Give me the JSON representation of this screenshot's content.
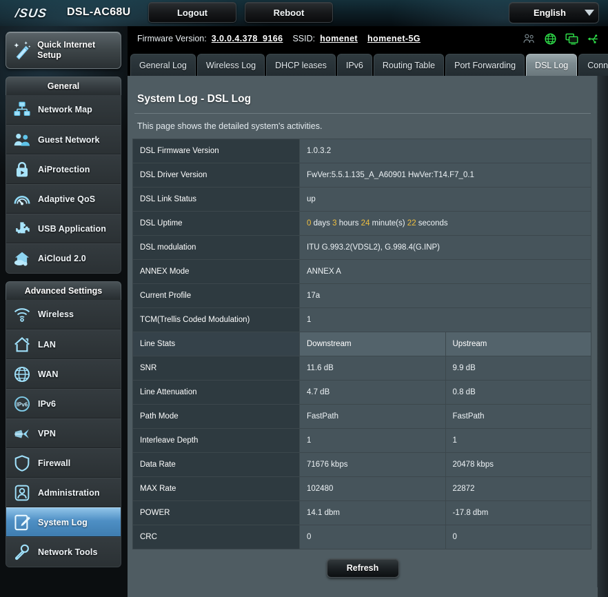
{
  "header": {
    "brand": "/SUS",
    "model": "DSL-AC68U",
    "logout_label": "Logout",
    "reboot_label": "Reboot",
    "language": "English",
    "accent_color": "#4e8fc4",
    "status_icons": [
      "guest-users-icon",
      "globe-icon",
      "monitor-icon",
      "usb-icon"
    ]
  },
  "infobar": {
    "firmware_label": "Firmware Version:",
    "firmware_value": "3.0.0.4.378_9166",
    "ssid_label": "SSID:",
    "ssid_2g": "homenet",
    "ssid_5g": "homenet-5G"
  },
  "sidebar": {
    "quick_setup": "Quick Internet Setup",
    "general_header": "General",
    "general_items": [
      {
        "label": "Network Map",
        "icon": "network-map-icon"
      },
      {
        "label": "Guest Network",
        "icon": "guest-network-icon"
      },
      {
        "label": "AiProtection",
        "icon": "lock-shield-icon"
      },
      {
        "label": "Adaptive QoS",
        "icon": "gauge-icon"
      },
      {
        "label": "USB Application",
        "icon": "puzzle-icon"
      },
      {
        "label": "AiCloud 2.0",
        "icon": "cloud-house-icon"
      }
    ],
    "advanced_header": "Advanced Settings",
    "advanced_items": [
      {
        "label": "Wireless",
        "icon": "wifi-icon",
        "active": false
      },
      {
        "label": "LAN",
        "icon": "house-icon",
        "active": false
      },
      {
        "label": "WAN",
        "icon": "globe-icon",
        "active": false
      },
      {
        "label": "IPv6",
        "icon": "ipv6-globe-icon",
        "active": false
      },
      {
        "label": "VPN",
        "icon": "vpn-key-icon",
        "active": false
      },
      {
        "label": "Firewall",
        "icon": "shield-icon",
        "active": false
      },
      {
        "label": "Administration",
        "icon": "user-badge-icon",
        "active": false
      },
      {
        "label": "System Log",
        "icon": "notepad-pencil-icon",
        "active": true
      },
      {
        "label": "Network Tools",
        "icon": "wrench-icon",
        "active": false
      }
    ]
  },
  "tabs": [
    {
      "label": "General Log",
      "active": false
    },
    {
      "label": "Wireless Log",
      "active": false
    },
    {
      "label": "DHCP leases",
      "active": false
    },
    {
      "label": "IPv6",
      "active": false
    },
    {
      "label": "Routing Table",
      "active": false
    },
    {
      "label": "Port Forwarding",
      "active": false
    },
    {
      "label": "DSL Log",
      "active": true
    },
    {
      "label": "Connections",
      "active": false
    }
  ],
  "main": {
    "title": "System Log - DSL Log",
    "description": "This page shows the detailed system's activities.",
    "refresh_label": "Refresh",
    "info_rows": [
      {
        "key": "DSL Firmware Version",
        "value": "1.0.3.2"
      },
      {
        "key": "DSL Driver Version",
        "value": "FwVer:5.5.1.135_A_A60901 HwVer:T14.F7_0.1"
      },
      {
        "key": "DSL Link Status",
        "value": "up"
      },
      {
        "key": "DSL Uptime",
        "value": "0 days 3 hours 24 minute(s) 22 seconds",
        "uptime_parts": [
          {
            "num": "0",
            "unit": " days "
          },
          {
            "num": "3",
            "unit": " hours "
          },
          {
            "num": "24",
            "unit": " minute(s) "
          },
          {
            "num": "22",
            "unit": " seconds"
          }
        ]
      },
      {
        "key": "DSL modulation",
        "value": "ITU G.993.2(VDSL2), G.998.4(G.INP)"
      },
      {
        "key": "ANNEX Mode",
        "value": "ANNEX A"
      },
      {
        "key": "Current Profile",
        "value": "17a"
      },
      {
        "key": "TCM(Trellis Coded Modulation)",
        "value": "1"
      }
    ],
    "line_stats_header": {
      "key": "Line Stats",
      "down": "Downstream",
      "up": "Upstream"
    },
    "line_stats_rows": [
      {
        "key": "SNR",
        "down": "11.6 dB",
        "up": "9.9 dB"
      },
      {
        "key": "Line Attenuation",
        "down": "4.7 dB",
        "up": "0.8 dB"
      },
      {
        "key": "Path Mode",
        "down": "FastPath",
        "up": "FastPath"
      },
      {
        "key": "Interleave Depth",
        "down": "1",
        "up": "1"
      },
      {
        "key": "Data Rate",
        "down": "71676 kbps",
        "up": "20478 kbps"
      },
      {
        "key": "MAX Rate",
        "down": "102480",
        "up": "22872"
      },
      {
        "key": "POWER",
        "down": "14.1 dbm",
        "up": "-17.8 dbm"
      },
      {
        "key": "CRC",
        "down": "0",
        "up": "0"
      }
    ]
  }
}
